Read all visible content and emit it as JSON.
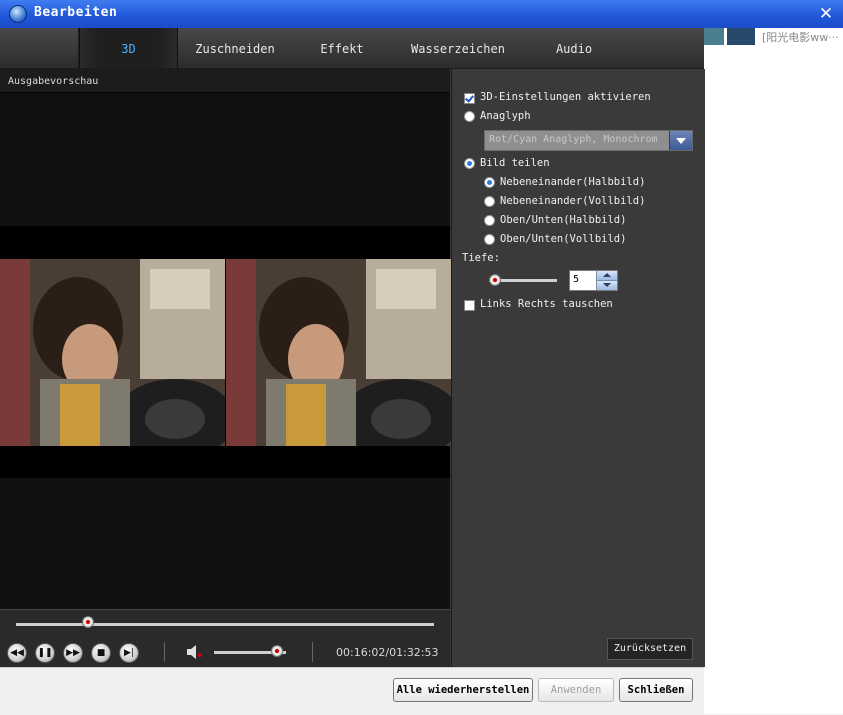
{
  "window": {
    "title": "Bearbeiten"
  },
  "background_app": {
    "text": "[阳光电影ww···"
  },
  "tabs": [
    {
      "label": "3D",
      "active": true
    },
    {
      "label": "Zuschneiden",
      "active": false
    },
    {
      "label": "Effekt",
      "active": false
    },
    {
      "label": "Wasserzeichen",
      "active": false
    },
    {
      "label": "Audio",
      "active": false
    }
  ],
  "preview": {
    "label": "Ausgabevorschau",
    "seek_position": 0.17,
    "volume_level": 0.86,
    "time": "00:16:02/01:32:53",
    "icons": [
      "rewind-icon",
      "pause-icon",
      "fast-forward-icon",
      "stop-icon",
      "next-frame-icon",
      "speaker-icon"
    ]
  },
  "settings": {
    "enable_3d": {
      "label": "3D-Einstellungen aktivieren",
      "checked": true
    },
    "anaglyph": {
      "label": "Anaglyph",
      "selected": false
    },
    "anaglyph_select": {
      "value": "Rot/Cyan Anaglyph, Monochrom"
    },
    "split": {
      "label": "Bild teilen",
      "selected": true
    },
    "split_options": [
      {
        "label": "Nebeneinander(Halbbild)",
        "selected": true
      },
      {
        "label": "Nebeneinander(Vollbild)",
        "selected": false
      },
      {
        "label": "Oben/Unten(Halbbild)",
        "selected": false
      },
      {
        "label": "Oben/Unten(Vollbild)",
        "selected": false
      }
    ],
    "depth": {
      "label": "Tiefe:",
      "value": "5"
    },
    "swap": {
      "label": "Links Rechts tauschen",
      "checked": false
    },
    "reset_label": "Zurücksetzen"
  },
  "footer": {
    "restore_all": "Alle wiederherstellen",
    "apply": "Anwenden",
    "close": "Schließen"
  },
  "colors": {
    "titlebar": "#1f56d8",
    "active_tab": "#4fb3ff",
    "panel": "#3a3a3a"
  }
}
